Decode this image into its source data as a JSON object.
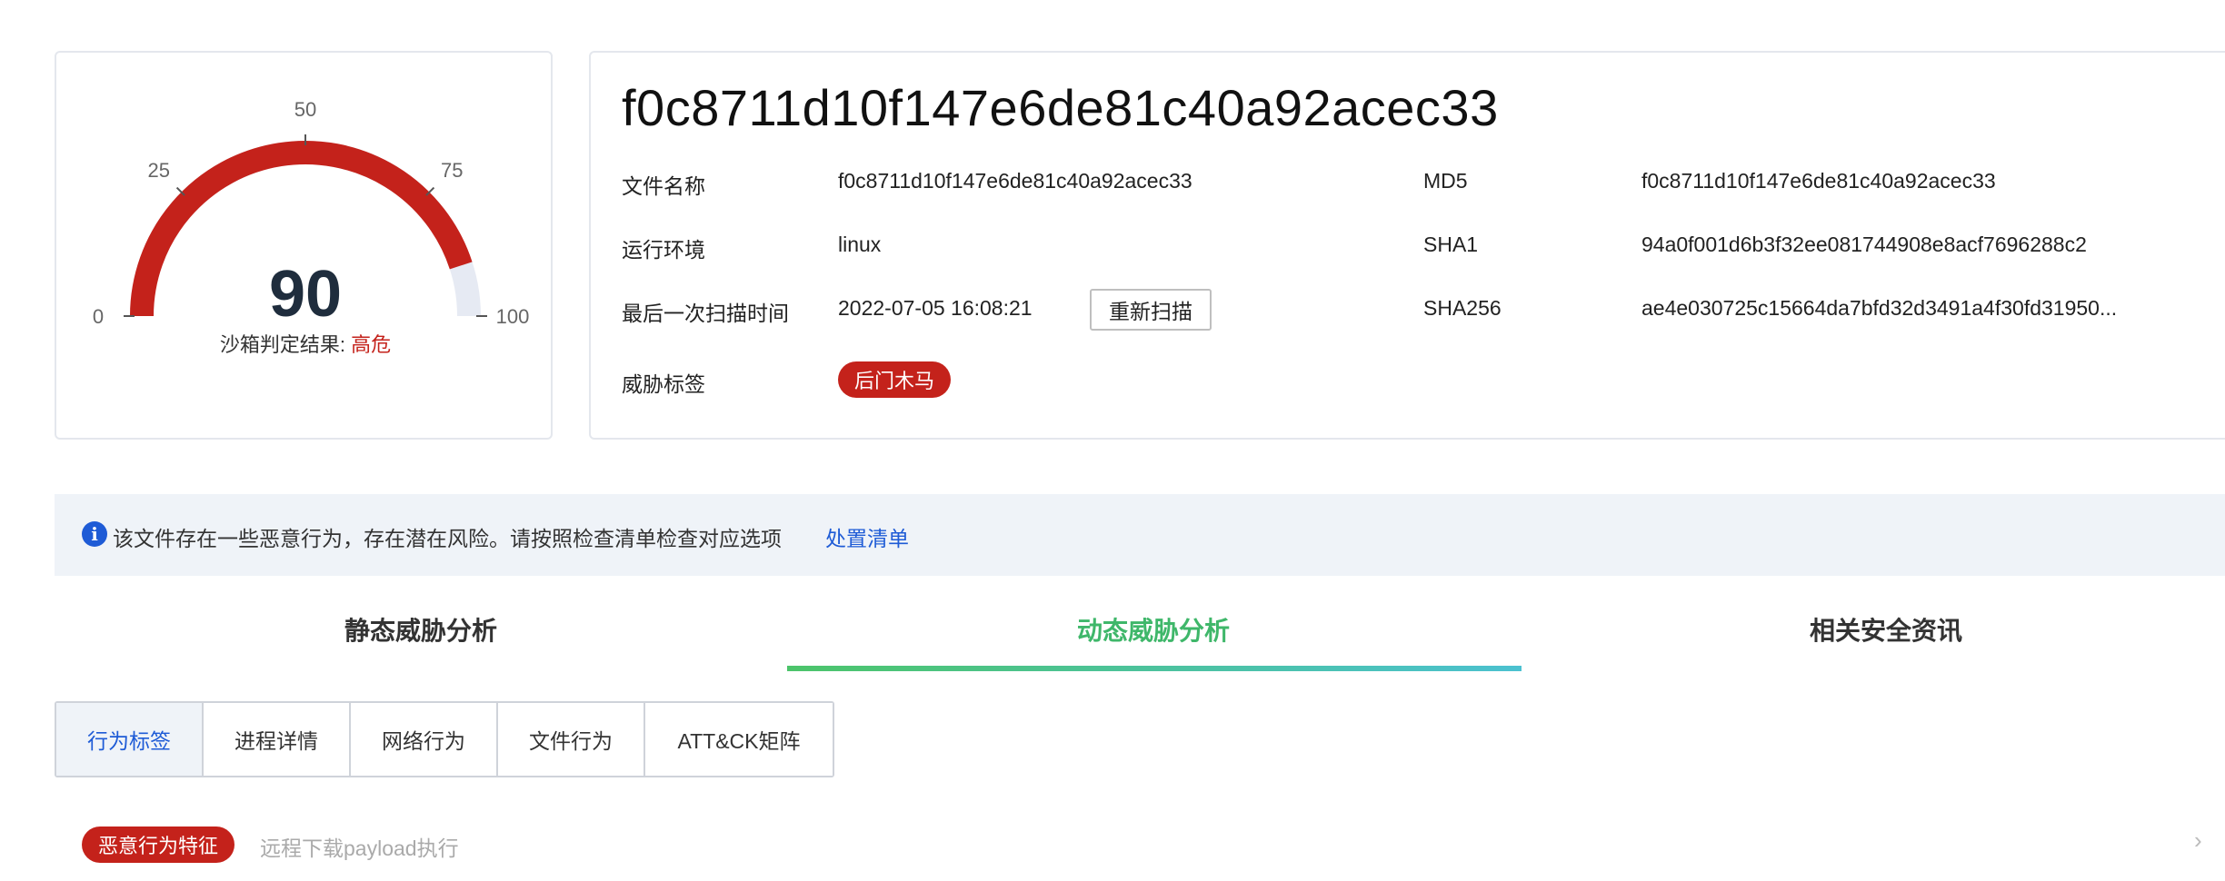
{
  "gauge": {
    "score": "90",
    "score_value": 90,
    "min": 0,
    "max": 100,
    "ticks": [
      "0",
      "25",
      "50",
      "75",
      "100"
    ],
    "verdict_label": "沙箱判定结果: ",
    "verdict_value": "高危",
    "colors": {
      "fill": "#c4221b",
      "track": "#e6eaf3"
    }
  },
  "file": {
    "hash_title": "f0c8711d10f147e6de81c40a92acec33",
    "fields_left": [
      {
        "label": "文件名称",
        "value": "f0c8711d10f147e6de81c40a92acec33"
      },
      {
        "label": "运行环境",
        "value": "linux"
      },
      {
        "label": "最后一次扫描时间",
        "value": "2022-07-05 16:08:21"
      }
    ],
    "rescan_label": "重新扫描",
    "threat_label": "威胁标签",
    "threat_tag": "后门木马",
    "fields_right": [
      {
        "label": "MD5",
        "value": "f0c8711d10f147e6de81c40a92acec33"
      },
      {
        "label": "SHA1",
        "value": "94a0f001d6b3f32ee081744908e8acf7696288c2"
      },
      {
        "label": "SHA256",
        "value": "ae4e030725c15664da7bfd32d3491a4f30fd31950..."
      }
    ]
  },
  "notice": {
    "icon": "info-icon",
    "text": "该文件存在一些恶意行为，存在潜在风险。请按照检查清单检查对应选项",
    "link": "处置清单"
  },
  "main_tabs": [
    {
      "label": "静态威胁分析",
      "active": false
    },
    {
      "label": "动态威胁分析",
      "active": true
    },
    {
      "label": "相关安全资讯",
      "active": false
    }
  ],
  "sub_tabs": [
    {
      "label": "行为标签",
      "active": true
    },
    {
      "label": "进程详情",
      "active": false
    },
    {
      "label": "网络行为",
      "active": false
    },
    {
      "label": "文件行为",
      "active": false
    },
    {
      "label": "ATT&CK矩阵",
      "active": false
    }
  ],
  "behavior": {
    "tag": "恶意行为特征",
    "description": "远程下载payload执行",
    "chevron_icon": "chevron-right-icon"
  },
  "colors": {
    "accent": "#1e5bd6",
    "danger": "#c4221b",
    "active_tab": "#3fb76a"
  }
}
